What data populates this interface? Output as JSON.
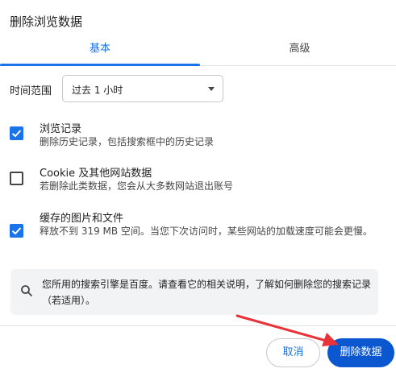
{
  "dialog": {
    "title": "删除浏览数据"
  },
  "tabs": [
    {
      "label": "基本",
      "active": true
    },
    {
      "label": "高级",
      "active": false
    }
  ],
  "time_range": {
    "label": "时间范围",
    "selected": "过去 1 小时"
  },
  "options": [
    {
      "title": "浏览记录",
      "description": "删除历史记录，包括搜索框中的历史记录",
      "checked": true
    },
    {
      "title": "Cookie 及其他网站数据",
      "description": "若删除此类数据，您会从大多数网站退出账号",
      "checked": false
    },
    {
      "title": "缓存的图片和文件",
      "description": "释放不到 319 MB 空间。当您下次访问时，某些网站的加载速度可能会更慢。",
      "checked": true
    }
  ],
  "info": {
    "icon": "search-icon",
    "text": "您所用的搜索引擎是百度。请查看它的相关说明，了解如何删除您的搜索记录（若适用）。"
  },
  "buttons": {
    "cancel": "取消",
    "delete": "删除数据"
  },
  "colors": {
    "accent": "#1a73e8",
    "primary_button": "#0b57d0",
    "annotation_arrow": "#e8333a"
  }
}
